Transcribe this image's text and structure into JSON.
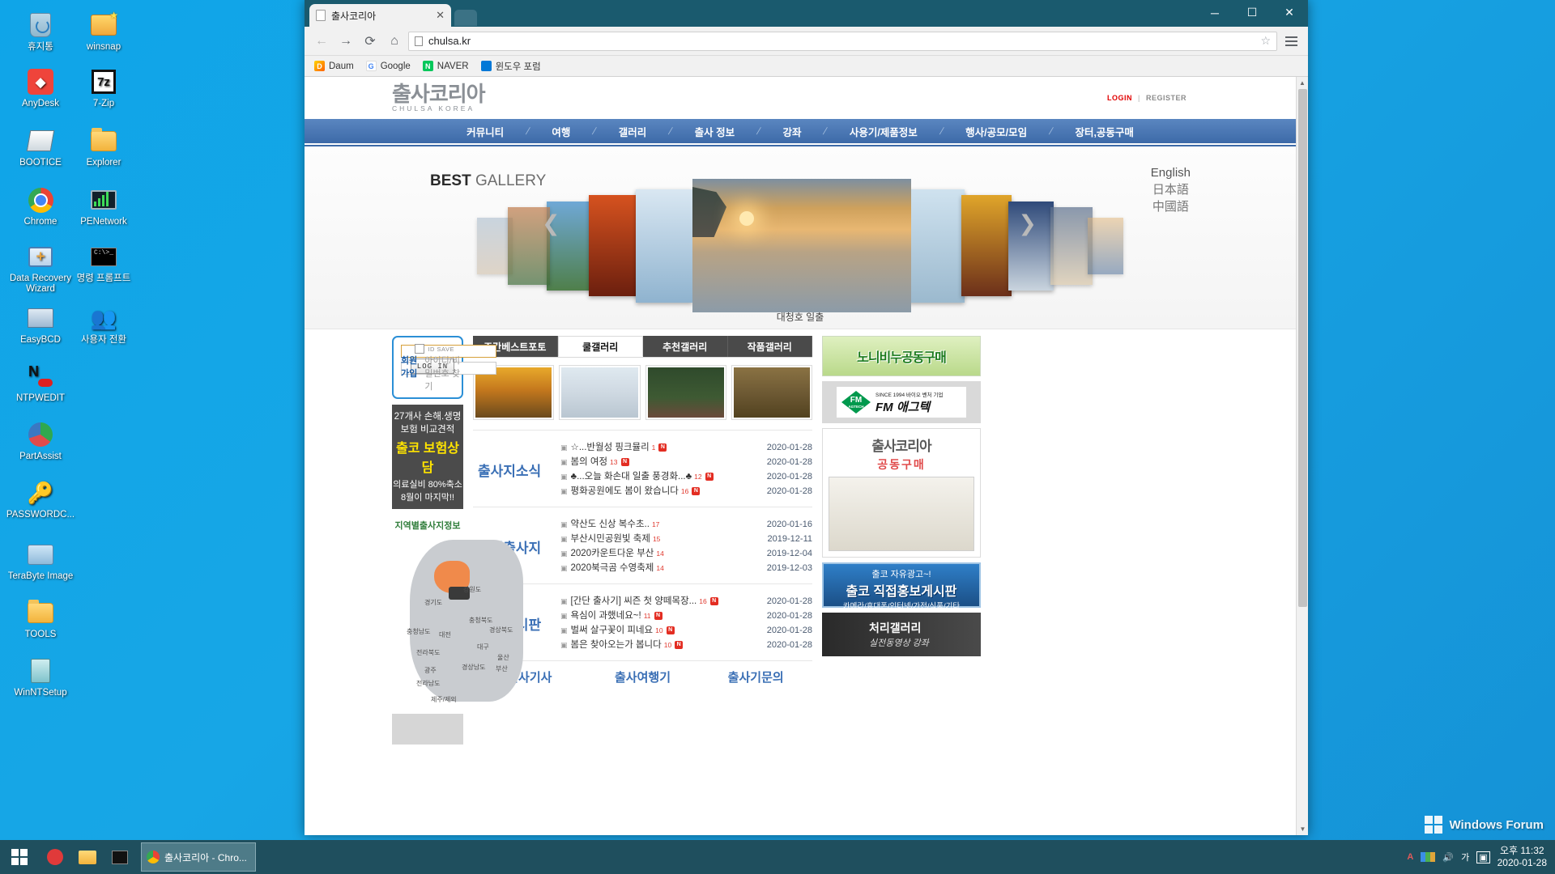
{
  "desktop": {
    "icons": [
      {
        "label": "휴지통",
        "icon": "recycle-bin-icon"
      },
      {
        "label": "winsnap",
        "icon": "winsnap-icon"
      },
      {
        "label": "AnyDesk",
        "icon": "anydesk-icon"
      },
      {
        "label": "7-Zip",
        "icon": "sevenzip-icon"
      },
      {
        "label": "BOOTICE",
        "icon": "bootice-icon"
      },
      {
        "label": "Explorer",
        "icon": "explorer-folder-icon"
      },
      {
        "label": "Chrome",
        "icon": "chrome-icon"
      },
      {
        "label": "PENetwork",
        "icon": "penetwork-icon"
      },
      {
        "label": "Data Recovery Wizard",
        "icon": "data-recovery-wizard-icon"
      },
      {
        "label": "명령 프롬프트",
        "icon": "command-prompt-icon"
      },
      {
        "label": "EasyBCD",
        "icon": "easybcd-icon"
      },
      {
        "label": "사용자 전환",
        "icon": "switch-user-icon"
      },
      {
        "label": "NTPWEDIT",
        "icon": "ntpwedit-icon"
      },
      {
        "label": "PartAssist",
        "icon": "partassist-icon"
      },
      {
        "label": "PASSWORDC...",
        "icon": "password-key-icon"
      },
      {
        "label": "TeraByte Image",
        "icon": "terabyte-image-icon"
      },
      {
        "label": "TOOLS",
        "icon": "tools-folder-icon"
      },
      {
        "label": "WinNTSetup",
        "icon": "winntsetup-icon"
      }
    ],
    "watermark": "Windows Forum"
  },
  "taskbar": {
    "start_label": "start-button",
    "pinned": [
      "opera-icon",
      "file-explorer-icon",
      "console-icon"
    ],
    "task_label": "출사코리아 - Chro...",
    "tray_ime": "가",
    "clock_time": "오후 11:32",
    "clock_date": "2020-01-28"
  },
  "browser": {
    "tab_title": "출사코리아",
    "tab_close": "✕",
    "url": "chulsa.kr",
    "nav": {
      "back": "←",
      "forward": "→",
      "reload": "⟳",
      "home": "⌂",
      "star": "☆"
    },
    "bookmarks": [
      {
        "label": "Daum",
        "icon": "daum-icon",
        "mark": "D"
      },
      {
        "label": "Google",
        "icon": "google-icon",
        "mark": "G"
      },
      {
        "label": "NAVER",
        "icon": "naver-icon",
        "mark": "N"
      },
      {
        "label": "윈도우 포럼",
        "icon": "windows-forum-icon",
        "mark": ""
      }
    ],
    "window_controls": {
      "minimize": "─",
      "maximize": "☐",
      "close": "✕"
    }
  },
  "site": {
    "logo_ko": "출사코리아",
    "logo_en": "CHULSA KOREA",
    "login": "LOGIN",
    "separator": "|",
    "register": "REGISTER",
    "gnb": [
      "커뮤니티",
      "여행",
      "갤러리",
      "출사 정보",
      "강좌",
      "사용기/제품정보",
      "행사/공모/모임",
      "장터,공동구매"
    ],
    "carousel": {
      "title_bold": "BEST",
      "title_rest": " GALLERY",
      "caption": "대청호 일출",
      "prev": "❮",
      "next": "❯",
      "languages": [
        "English",
        "日本語",
        "中國語"
      ]
    },
    "login_box": {
      "id_placeholder": "",
      "pw_placeholder": "",
      "id_save": "ID SAVE",
      "login_button": "LOG IN",
      "join": "회원 가입",
      "find": "아이디/비밀번호 찾기"
    },
    "insurance_banner": {
      "line1": "27개사 손해.생명보험 비교견적",
      "line2": "출코 보험상담",
      "line3": "의료실비 80%축소 8월이 마지막!!"
    },
    "map": {
      "title": "지역별출사지정보",
      "labels": [
        "경기도",
        "강원도",
        "충청북도",
        "충청남도",
        "경상북도",
        "대전",
        "대구",
        "전라북도",
        "울산",
        "광주",
        "경상남도",
        "부산",
        "전라남도",
        "제주/제외"
      ]
    },
    "gallery_tabs": [
      {
        "label": "주간베스트포토",
        "active": false
      },
      {
        "label": "쿨갤러리",
        "active": true
      },
      {
        "label": "추천갤러리",
        "active": false
      },
      {
        "label": "작품갤러리",
        "active": false
      }
    ],
    "gallery_thumbs": [
      "golden-landscape-photo",
      "snow-bridge-photo",
      "bamboo-forest-photo",
      "autumn-leaves-photo"
    ],
    "list_blocks": [
      {
        "title": "출사지소식",
        "rows": [
          {
            "title": "☆...반월성 핑크뮬리",
            "count": "1",
            "new": "N",
            "date": "2020-01-28"
          },
          {
            "title": "봄의 여정",
            "count": "13",
            "new": "N",
            "date": "2020-01-28"
          },
          {
            "title": "♣...오늘 화손대 일출 풍경화...♣",
            "count": "12",
            "new": "N",
            "date": "2020-01-28"
          },
          {
            "title": "평화공원에도 봄이 왔습니다",
            "count": "16",
            "new": "N",
            "date": "2020-01-28"
          }
        ]
      },
      {
        "title": "추천출사지",
        "rows": [
          {
            "title": "약산도 신상 복수초..",
            "count": "17",
            "new": "",
            "date": "2020-01-16"
          },
          {
            "title": "부산시민공원빛 축제",
            "count": "15",
            "new": "",
            "date": "2019-12-11"
          },
          {
            "title": "2020카운트다운 부산",
            "count": "14",
            "new": "",
            "date": "2019-12-04"
          },
          {
            "title": "2020북극곰 수영축제",
            "count": "14",
            "new": "",
            "date": "2019-12-03"
          }
        ]
      },
      {
        "title": "자유게시판",
        "rows": [
          {
            "title": "[간단 출사기] 씨즌 첫 양떼목장...",
            "count": "16",
            "new": "N",
            "date": "2020-01-28"
          },
          {
            "title": "욕심이 과했네요~!",
            "count": "11",
            "new": "N",
            "date": "2020-01-28"
          },
          {
            "title": "벌써 살구꽃이 피네요",
            "count": "10",
            "new": "N",
            "date": "2020-01-28"
          },
          {
            "title": "봄은 찾아오는가 봅니다",
            "count": "10",
            "new": "N",
            "date": "2020-01-28"
          }
        ]
      }
    ],
    "bottom_tabs": [
      "출사기사",
      "출사여행기",
      "출사기문의"
    ],
    "right_banners": {
      "noni": "노니비누공동구매",
      "fm": {
        "sub": "SINCE 1994   바이오 벤처 기업",
        "name": "FM 애그텍",
        "mark": "FM",
        "mark_sub": "AGTECH"
      },
      "chulsa_group": {
        "title": "출사코리아",
        "sub": "공동구매"
      },
      "ad": {
        "line1": "출코 자유광고~!",
        "line2": "출코 직접홍보게시판",
        "line3": "카메라/휴대폰/인터넷/가전/식품/기타"
      },
      "lecture": {
        "line1": "처리갤러리",
        "line2": "실전동영상 강좌"
      }
    }
  }
}
